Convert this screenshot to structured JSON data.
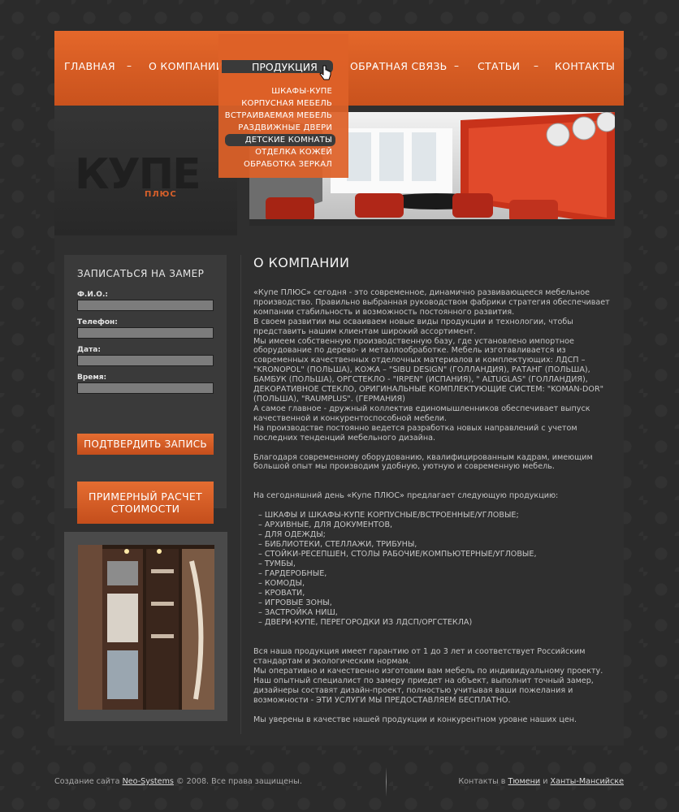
{
  "colors": {
    "accent": "#d8602a",
    "panel": "#3a3a3a",
    "page_bg": "#2b2b2b"
  },
  "nav": {
    "items": [
      "ГЛАВНАЯ",
      "О КОМПАНИИ",
      "ПРОДУКЦИЯ",
      "ОБРАТНАЯ СВЯЗЬ",
      "СТАТЬИ",
      "КОНТАКТЫ"
    ],
    "separator": "–"
  },
  "dropdown": {
    "items": [
      "ШКАФЫ-КУПЕ",
      "КОРПУСНАЯ МЕБЕЛЬ",
      "ВСТРАИВАЕМАЯ МЕБЕЛЬ",
      "РАЗДВИЖНЫЕ ДВЕРИ",
      "ДЕТСКИЕ КОМНАТЫ",
      "ОТДЕЛКА КОЖЕЙ",
      "ОБРАБОТКА ЗЕРКАЛ"
    ],
    "selected": "ДЕТСКИЕ КОМНАТЫ"
  },
  "logo": {
    "text": "КУПЕ",
    "sub": "ПЛЮС"
  },
  "form": {
    "title": "ЗАПИСАТЬСЯ НА ЗАМЕР",
    "fields": [
      "Ф.И.О.:",
      "Телефон:",
      "Дата:",
      "Время:"
    ],
    "submit": "ПОДТВЕРДИТЬ ЗАПИСЬ",
    "calc": "ПРИМЕРНЫЙ РАСЧЕТ СТОИМОСТИ"
  },
  "main": {
    "title": "О КОМПАНИИ",
    "p1": "«Купе ПЛЮС» сегодня - это современное, динамично развивающееся мебельное производство. Правильно выбранная руководством фабрики стратегия обеспечивает компании стабильность и возможность постоянного развития.\nВ своем развитии мы осваиваем новые виды продукции и технологии, чтобы представить нашим клиентам широкий ассортимент.\nМы имеем собственную производственную базу, где установлено импортное оборудование по дерево- и металлообработке. Мебель изготавливается из современных качественных отделочных материалов и комплектующих: ЛДСП – \"KRONOPOL\" (ПОЛЬША), КОЖА – \"SIBU DESIGN\" (ГОЛЛАНДИЯ), РАТАНГ (ПОЛЬША), БАМБУК (ПОЛЬША), ОРГСТЕКЛО - \"IRPEN\" (ИСПАНИЯ), \" ALTUGLAS\" (ГОЛЛАНДИЯ), ДЕКОРАТИВНОЕ СТЕКЛО, ОРИГИНАЛЬНЫЕ КОМПЛЕКТУЮЩИЕ СИСТЕМ: \"KOMAN-DOR\" (ПОЛЬША), \"RAUMPLUS\". (ГЕРМАНИЯ)\nА самое главное - дружный коллектив единомышленников обеспечивает выпуск качественной и конкурентоспособной мебели.\n На производстве постоянно ведется разработка новых направлений с учетом последних тенденций мебельного дизайна.",
    "p2": "Благодаря современному оборудованию, квалифицированным кадрам, имеющим большой опыт мы производим удобную, уютную и современную мебель.",
    "p3": "На сегодняшний день «Купе ПЛЮС»  предлагает следующую продукцию:",
    "products": [
      "ШКАФЫ И ШКАФЫ-КУПЕ КОРПУСНЫЕ/ВСТРОЕННЫЕ/УГЛОВЫЕ;",
      "АРХИВНЫЕ, ДЛЯ ДОКУМЕНТОВ,",
      "ДЛЯ ОДЕЖДЫ;",
      "БИБЛИОТЕКИ, СТЕЛЛАЖИ, ТРИБУНЫ,",
      "СТОЙКИ-РЕСЕПШЕН, СТОЛЫ РАБОЧИЕ/КОМПЬЮТЕРНЫЕ/УГЛОВЫЕ,",
      "ТУМБЫ,",
      "ГАРДЕРОБНЫЕ,",
      "КОМОДЫ,",
      "КРОВАТИ,",
      " ИГРОВЫЕ ЗОНЫ,",
      "ЗАСТРОЙКА НИШ,",
      "ДВЕРИ-КУПЕ, ПЕРЕГОРОДКИ ИЗ ЛДСП/ОРГСТЕКЛА)"
    ],
    "p4": "Вся наша продукция имеет гарантию от 1 до 3 лет и соответствует Российским стандартам и экологическим нормам.\nМы оперативно и качественно изготовим вам мебель по индивидуальному проекту. Наш опытный специалист по замеру приедет на объект, выполнит точный замер, дизайнеры составят дизайн-проект, полностью учитывая ваши пожелания и возможности - ЭТИ УСЛУГИ МЫ ПРЕДОСТАВЛЯЕМ БЕСПЛАТНО.",
    "p5": "Мы уверены в качестве нашей продукции и конкурентном уровне наших цен."
  },
  "footer": {
    "left_prefix": "Создание сайта",
    "left_link": "Neo-Systems",
    "left_suffix": "© 2008. Все права защищены.",
    "right_prefix": "Контакты в",
    "right_link1": "Тюмени",
    "right_and": "и",
    "right_link2": "Ханты-Мансийске"
  }
}
